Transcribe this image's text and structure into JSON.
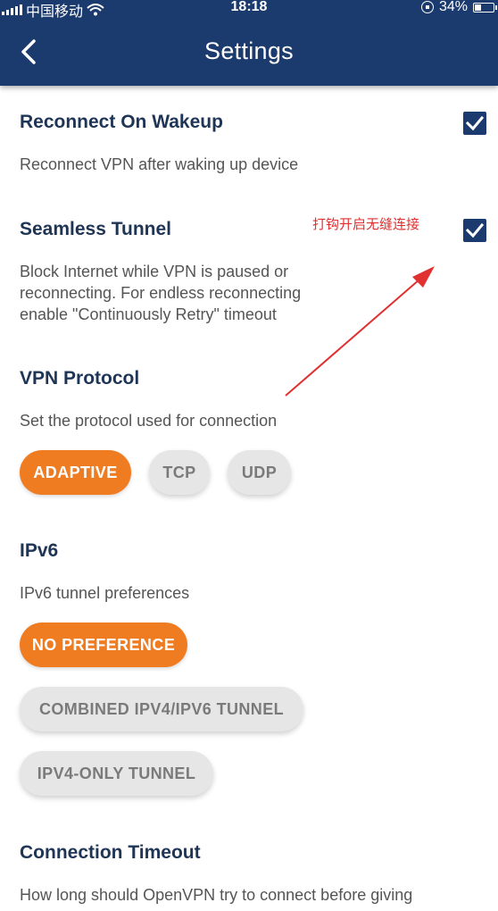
{
  "status_bar": {
    "carrier": "中国移动",
    "time": "18:18",
    "battery_percent": "34%",
    "battery_level": 0.34
  },
  "header": {
    "title": "Settings",
    "back_icon": "chevron-left-icon"
  },
  "settings": {
    "reconnect": {
      "title": "Reconnect On Wakeup",
      "description": "Reconnect VPN after waking up device",
      "checked": true
    },
    "seamless": {
      "title": "Seamless Tunnel",
      "description_lines": [
        "Block Internet while VPN is paused or",
        "reconnecting. For endless reconnecting",
        "enable \"Continuously Retry\" timeout"
      ],
      "checked": true
    },
    "protocol": {
      "title": "VPN Protocol",
      "description": "Set the protocol used for connection",
      "options": [
        "ADAPTIVE",
        "TCP",
        "UDP"
      ],
      "selected": "ADAPTIVE"
    },
    "ipv6": {
      "title": "IPv6",
      "description": "IPv6 tunnel preferences",
      "options": [
        "NO PREFERENCE",
        "COMBINED IPV4/IPV6 TUNNEL",
        "IPV4-ONLY TUNNEL"
      ],
      "selected": "NO PREFERENCE"
    },
    "timeout": {
      "title": "Connection Timeout",
      "description": "How long should OpenVPN try to connect before giving"
    }
  },
  "annotation": {
    "text": "打钩开启无缝连接",
    "color": "#e03030"
  },
  "colors": {
    "header_bg": "#1b3a6e",
    "accent": "#f07c22",
    "checkbox": "#1b3a6e"
  }
}
